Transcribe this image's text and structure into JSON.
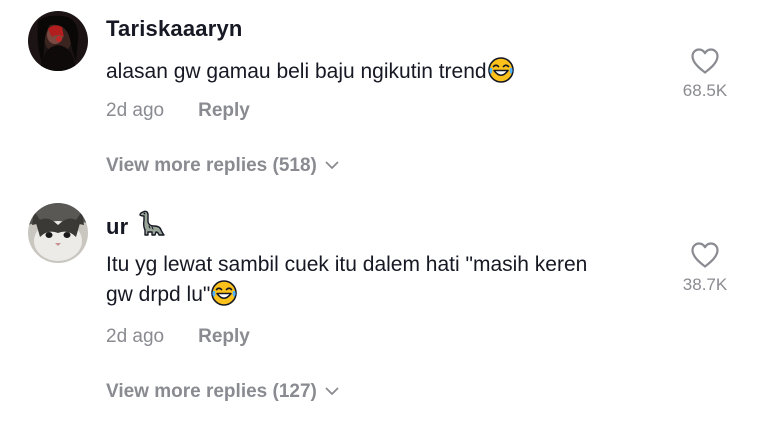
{
  "comments": [
    {
      "username": "Tariskaaaryn",
      "text": "alasan gw gamau beli baju ngikutin trend",
      "text_emoji": "face-with-tears-of-joy-emoji",
      "time": "2d ago",
      "reply_label": "Reply",
      "likes": "68.5K",
      "view_more": "View more replies (518)"
    },
    {
      "username": "ur",
      "username_badge": "dinosaur-emoji",
      "text_line1": "Itu yg lewat sambil cuek itu dalem hati \"masih keren",
      "text_line2": "gw drpd lu\"",
      "text_emoji": "face-with-tears-of-joy-emoji",
      "time": "2d ago",
      "reply_label": "Reply",
      "likes": "38.7K",
      "view_more": "View more replies (127)"
    }
  ],
  "colors": {
    "primary_text": "#161823",
    "secondary_text": "#8a8b91",
    "background": "#ffffff"
  }
}
